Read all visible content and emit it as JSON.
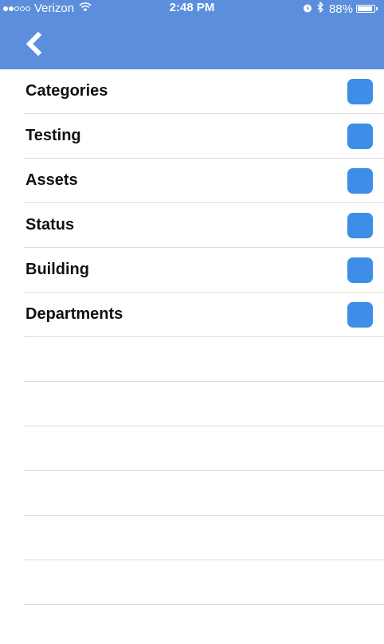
{
  "status_bar": {
    "signal_dots": [
      true,
      true,
      false,
      false,
      false
    ],
    "carrier": "Verizon",
    "wifi_icon": "wifi-icon",
    "time": "2:48 PM",
    "alarm_icon": "alarm-icon",
    "bluetooth_icon": "bluetooth-icon",
    "battery_percent": "88%",
    "battery_icon": "battery-icon"
  },
  "nav": {
    "back_icon": "chevron-left-icon"
  },
  "list": {
    "items": [
      {
        "label": "Categories"
      },
      {
        "label": "Testing"
      },
      {
        "label": "Assets"
      },
      {
        "label": "Status"
      },
      {
        "label": "Building"
      },
      {
        "label": "Departments"
      }
    ]
  },
  "colors": {
    "header": "#5b8fdd",
    "checkbox": "#3d8ee6",
    "separator": "#dcdcdc"
  }
}
